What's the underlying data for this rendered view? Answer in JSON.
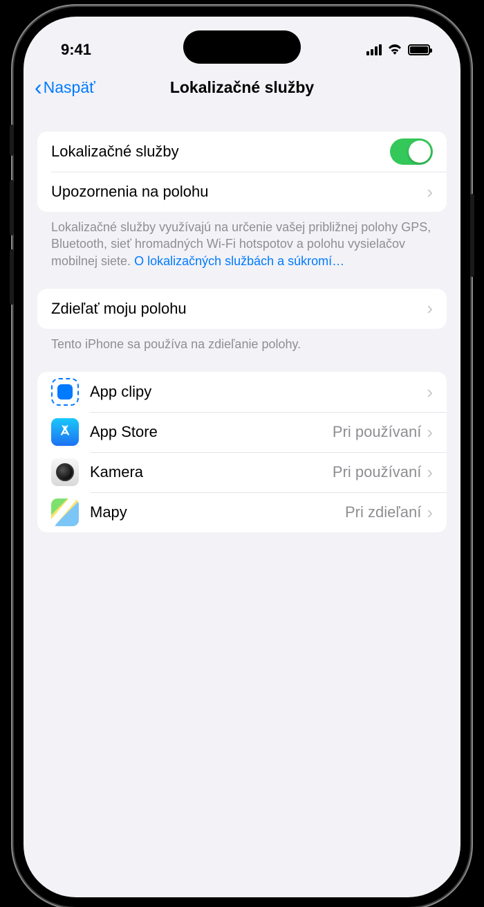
{
  "status": {
    "time": "9:41"
  },
  "nav": {
    "back": "Naspäť",
    "title": "Lokalizačné služby"
  },
  "section1": {
    "location_services_label": "Lokalizačné služby",
    "location_services_on": true,
    "location_alerts_label": "Upozornenia na polohu",
    "footer": "Lokalizačné služby využívajú na určenie vašej približnej polohy GPS, Bluetooth, sieť hromadných Wi-Fi hotspotov a polohu vysielačov mobilnej siete. ",
    "footer_link": "O lokalizačných službách a súkromí…"
  },
  "section2": {
    "share_location_label": "Zdieľať moju polohu",
    "footer": "Tento iPhone sa používa na zdieľanie polohy."
  },
  "apps": [
    {
      "name": "App clipy",
      "value": "",
      "icon": "appclips"
    },
    {
      "name": "App Store",
      "value": "Pri používaní",
      "icon": "appstore"
    },
    {
      "name": "Kamera",
      "value": "Pri používaní",
      "icon": "camera"
    },
    {
      "name": "Mapy",
      "value": "Pri zdieľaní",
      "icon": "maps"
    }
  ]
}
